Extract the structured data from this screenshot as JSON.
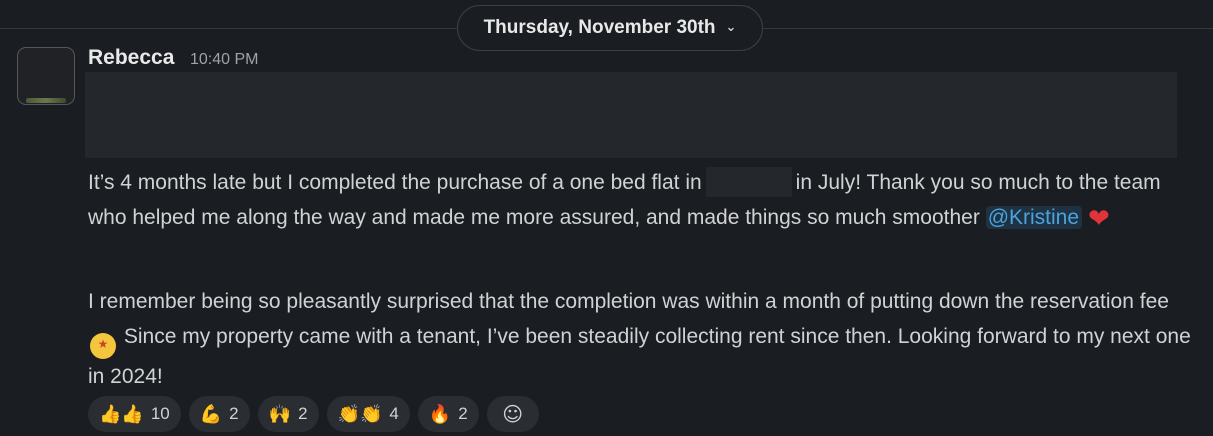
{
  "date_divider": {
    "label": "Thursday, November 30th",
    "chevron_icon": "chevron-down-icon"
  },
  "message": {
    "author": "Rebecca",
    "timestamp": "10:40 PM",
    "paragraph1": {
      "part1": "It’s 4 months late but I completed the purchase of a one bed flat in",
      "part2": "in July! Thank you so much to the team who helped me along the way and made me more assured, and made things so much smoother",
      "mention": "@Kristine",
      "emoji": "❤"
    },
    "paragraph2": {
      "part1": "I remember being so pleasantly surprised that the completion was within a month of putting down the reservation fee",
      "emoji": "★",
      "part2": "Since my property came with a tenant, I’ve been steadily collecting rent since then. Looking forward to my next one in 2024!"
    }
  },
  "reactions": [
    {
      "name": "thumbs-up-icon",
      "glyph": "👍👍",
      "count": "10"
    },
    {
      "name": "flexed-biceps-icon",
      "glyph": "💪",
      "count": "2"
    },
    {
      "name": "raised-hands-icon",
      "glyph": "🙌",
      "count": "2"
    },
    {
      "name": "clapping-hands-icon",
      "glyph": "👏👏",
      "count": "4"
    },
    {
      "name": "fire-icon",
      "glyph": "🔥",
      "count": "2"
    }
  ],
  "add_reaction": {
    "name": "add-reaction-icon",
    "glyph": "☺"
  },
  "colors": {
    "background": "#1a1d21",
    "mention_text": "#4aa3df",
    "mention_bg": "#1f3242",
    "reaction_bg": "#2a2d31"
  }
}
